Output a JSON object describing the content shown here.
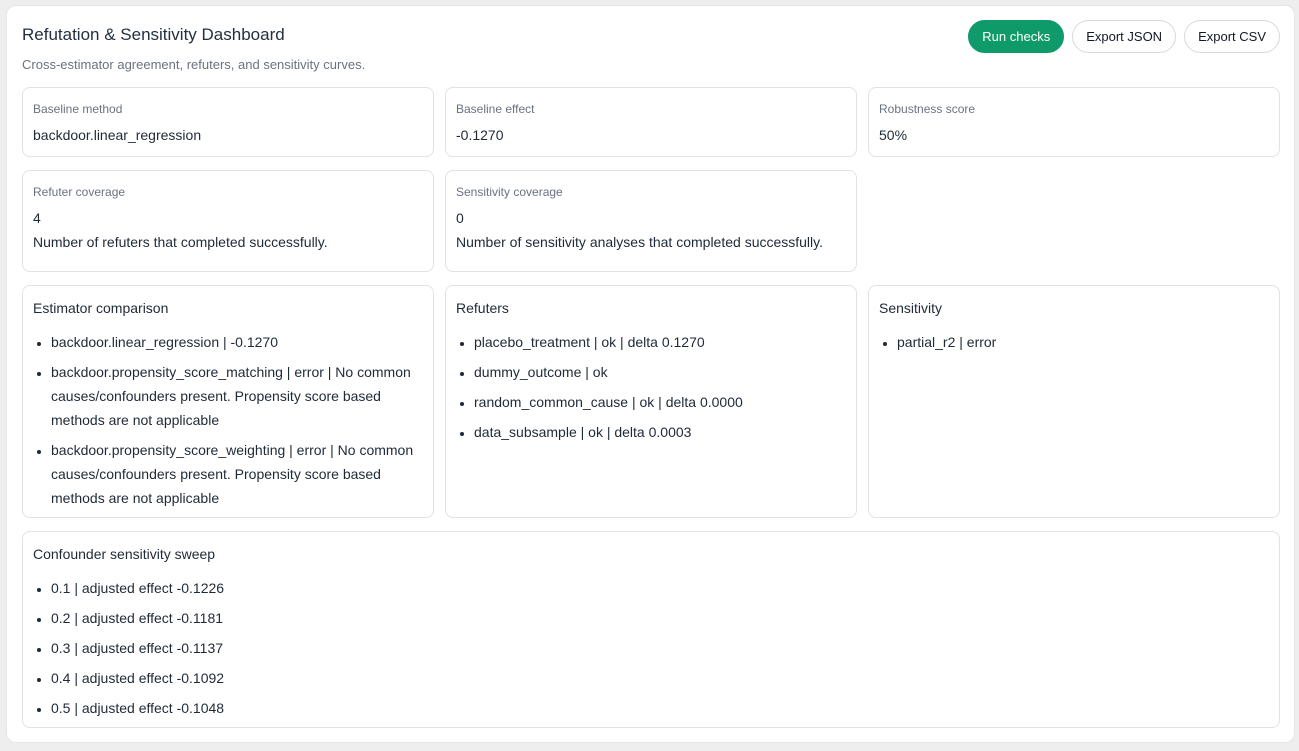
{
  "header": {
    "title": "Refutation & Sensitivity Dashboard",
    "subtitle": "Cross-estimator agreement, refuters, and sensitivity curves."
  },
  "actions": {
    "run_label": "Run checks",
    "export_json_label": "Export JSON",
    "export_csv_label": "Export CSV",
    "accent_color": "#0f9a6a"
  },
  "metrics": {
    "baseline_method": {
      "label": "Baseline method",
      "value": "backdoor.linear_regression"
    },
    "baseline_effect": {
      "label": "Baseline effect",
      "value": "-0.1270"
    },
    "robustness_score": {
      "label": "Robustness score",
      "value": "50%"
    },
    "refuter_coverage": {
      "label": "Refuter coverage",
      "value": "4",
      "description": "Number of refuters that completed successfully."
    },
    "sensitivity_coverage": {
      "label": "Sensitivity coverage",
      "value": "0",
      "description": "Number of sensitivity analyses that completed successfully."
    }
  },
  "estimator_comparison": {
    "title": "Estimator comparison",
    "items": [
      "backdoor.linear_regression | -0.1270",
      "backdoor.propensity_score_matching | error | No common causes/confounders present. Propensity score based methods are not applicable",
      "backdoor.propensity_score_weighting | error | No common causes/confounders present. Propensity score based methods are not applicable"
    ]
  },
  "refuters": {
    "title": "Refuters",
    "items": [
      "placebo_treatment | ok | delta 0.1270",
      "dummy_outcome | ok",
      "random_common_cause | ok | delta 0.0000",
      "data_subsample | ok | delta 0.0003"
    ]
  },
  "sensitivity": {
    "title": "Sensitivity",
    "items": [
      "partial_r2 | error"
    ]
  },
  "sweep": {
    "title": "Confounder sensitivity sweep",
    "items": [
      "0.1 | adjusted effect -0.1226",
      "0.2 | adjusted effect -0.1181",
      "0.3 | adjusted effect -0.1137",
      "0.4 | adjusted effect -0.1092",
      "0.5 | adjusted effect -0.1048"
    ]
  }
}
